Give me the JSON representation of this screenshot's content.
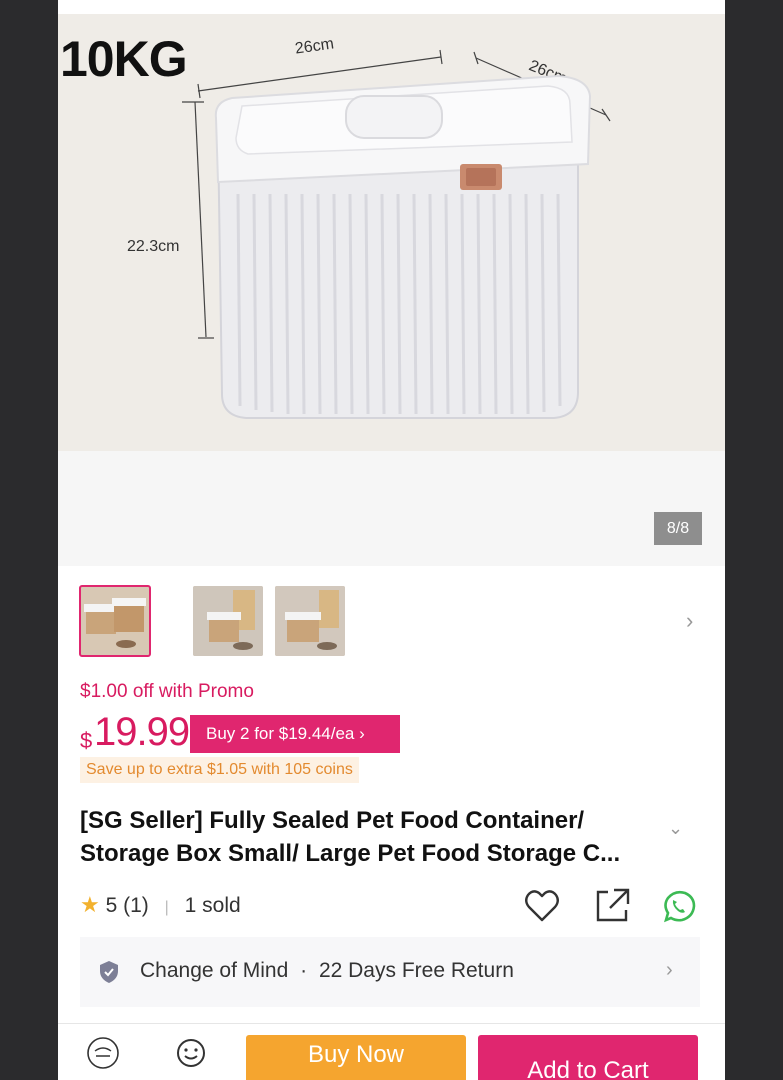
{
  "gallery": {
    "size_label": "10KG",
    "dim_width": "26cm",
    "dim_depth": "26cm",
    "dim_height": "22.3cm",
    "page_indicator": "8/8"
  },
  "thumbnails": [
    {
      "alt": "thumbnail-1"
    },
    {
      "alt": "thumbnail-2"
    },
    {
      "alt": "thumbnail-3"
    }
  ],
  "pricing": {
    "promo_text": "$1.00 off with Promo",
    "currency": "$",
    "price": "19.99",
    "bundle_offer": "Buy 2 for $19.44/ea ›",
    "coins_text": "Save up to extra $1.05 with 105 coins"
  },
  "product": {
    "title": "[SG Seller] Fully Sealed Pet Food Container/ Storage Box Small/ Large Pet Food Storage C...",
    "rating_value": "5",
    "rating_count": "(1)",
    "sold": "1 sold"
  },
  "returns": {
    "label": "Change of Mind",
    "dot": "·",
    "detail": "22 Days Free Return"
  },
  "bottom_bar": {
    "buy_now": "Buy Now",
    "add_to_cart": "Add to Cart"
  },
  "colors": {
    "accent": "#e0266f",
    "buy_now": "#f5a52f",
    "coins": "#e38a2f",
    "whatsapp": "#3cba54"
  },
  "icons": [
    "star-icon",
    "heart-icon",
    "share-icon",
    "whatsapp-icon",
    "shield-icon",
    "chevron-right-icon",
    "chevron-down-icon",
    "shop-icon",
    "chat-icon"
  ]
}
